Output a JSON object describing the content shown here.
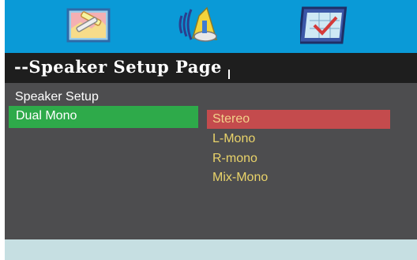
{
  "header": {
    "icons": [
      "tools-icon",
      "speaker-icon",
      "preferences-check-icon"
    ],
    "accent_color": "#0a9ad7"
  },
  "page": {
    "title": "--Speaker Setup Page"
  },
  "menu": {
    "section_label": "Speaker Setup",
    "selected_item": "Dual  Mono"
  },
  "options": {
    "items": [
      "Stereo",
      "L-Mono",
      "R-mono",
      "Mix-Mono"
    ],
    "selected_index": 0
  },
  "colors": {
    "selected_left": "#2eaa4a",
    "selected_option": "#c44b4d",
    "option_text": "#e9d36a"
  }
}
